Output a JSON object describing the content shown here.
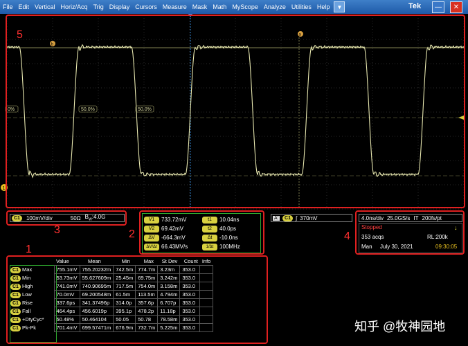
{
  "menu": {
    "items": [
      "File",
      "Edit",
      "Vertical",
      "Horiz/Acq",
      "Trig",
      "Display",
      "Cursors",
      "Measure",
      "Mask",
      "Math",
      "MyScope",
      "Analyze",
      "Utilities",
      "Help"
    ],
    "brand": "Tek",
    "minimize": "—",
    "close": "✕"
  },
  "scope": {
    "ref_levels": [
      "0%",
      "50.0%",
      "50.0%"
    ],
    "cursor_labels": [
      "b",
      "a"
    ],
    "trigger_marker": "1",
    "trace_color": "#e8e8b0"
  },
  "annotations": {
    "a1": "1",
    "a2": "2",
    "a3": "3",
    "a4": "4",
    "a5": "5"
  },
  "channel": {
    "tag": "C1",
    "scale": "100mV/div",
    "impedance": "50Ω",
    "bw_label": "B",
    "bw_sub": "W",
    "bw_value": ":4.0G"
  },
  "cursors_v": [
    {
      "label": "V1",
      "value": "733.72mV"
    },
    {
      "label": "V2",
      "value": "69.42mV"
    },
    {
      "label": "ΔV",
      "value": "-664.3mV"
    },
    {
      "label": "ΔV/Δt",
      "value": "66.43MV/s"
    }
  ],
  "cursors_t": [
    {
      "label": "t1",
      "value": "10.04ns"
    },
    {
      "label": "t2",
      "value": "40.0ps"
    },
    {
      "label": "Δt",
      "value": "-10.0ns"
    },
    {
      "label": "1/Δt",
      "value": "100MHz"
    }
  ],
  "trigger": {
    "tag": "A'",
    "channel": "C1",
    "level": "370mV"
  },
  "horizontal": {
    "scale": "4.0ns/div",
    "rate": "25.0GS/s",
    "mode": "IT",
    "resolution": "200fs/pt",
    "status": "Stopped",
    "acqs": "353 acqs",
    "record": "RL:200k",
    "mode2": "Man",
    "date": "July 30, 2021",
    "time": "09:30:05"
  },
  "measurements": {
    "headers": [
      "Value",
      "Mean",
      "Min",
      "Max",
      "St Dev",
      "Count",
      "Info"
    ],
    "rows": [
      {
        "ch": "C1",
        "name": "Max",
        "value": "755.1mV",
        "mean": "755.20232m",
        "min": "742.5m",
        "max": "774.7m",
        "stdev": "3.23m",
        "count": "353.0"
      },
      {
        "ch": "C1",
        "name": "Min",
        "value": "53.73mV",
        "mean": "55.627609m",
        "min": "25.45m",
        "max": "69.75m",
        "stdev": "3.242m",
        "count": "353.0"
      },
      {
        "ch": "C1",
        "name": "High",
        "value": "741.0mV",
        "mean": "740.90695m",
        "min": "717.5m",
        "max": "754.0m",
        "stdev": "3.158m",
        "count": "353.0"
      },
      {
        "ch": "C1",
        "name": "Low",
        "value": "70.0mV",
        "mean": "69.200548m",
        "min": "61.5m",
        "max": "113.5m",
        "stdev": "4.794m",
        "count": "353.0"
      },
      {
        "ch": "C1",
        "name": "Rise",
        "value": "337.6ps",
        "mean": "341.37496p",
        "min": "314.0p",
        "max": "357.6p",
        "stdev": "6.707p",
        "count": "353.0"
      },
      {
        "ch": "C1",
        "name": "Fall",
        "value": "464.4ps",
        "mean": "456.6019p",
        "min": "395.1p",
        "max": "478.2p",
        "stdev": "11.18p",
        "count": "353.0"
      },
      {
        "ch": "C1",
        "name": "+DtyCyc*",
        "value": "50.48%",
        "mean": "50.464104",
        "min": "50.05",
        "max": "50.78",
        "stdev": "78.58m",
        "count": "353.0"
      },
      {
        "ch": "C1",
        "name": "Pk-Pk",
        "value": "701.4mV",
        "mean": "699.57471m",
        "min": "676.9m",
        "max": "732.7m",
        "stdev": "5.225m",
        "count": "353.0"
      }
    ]
  },
  "watermark": "知乎 @牧神园地"
}
